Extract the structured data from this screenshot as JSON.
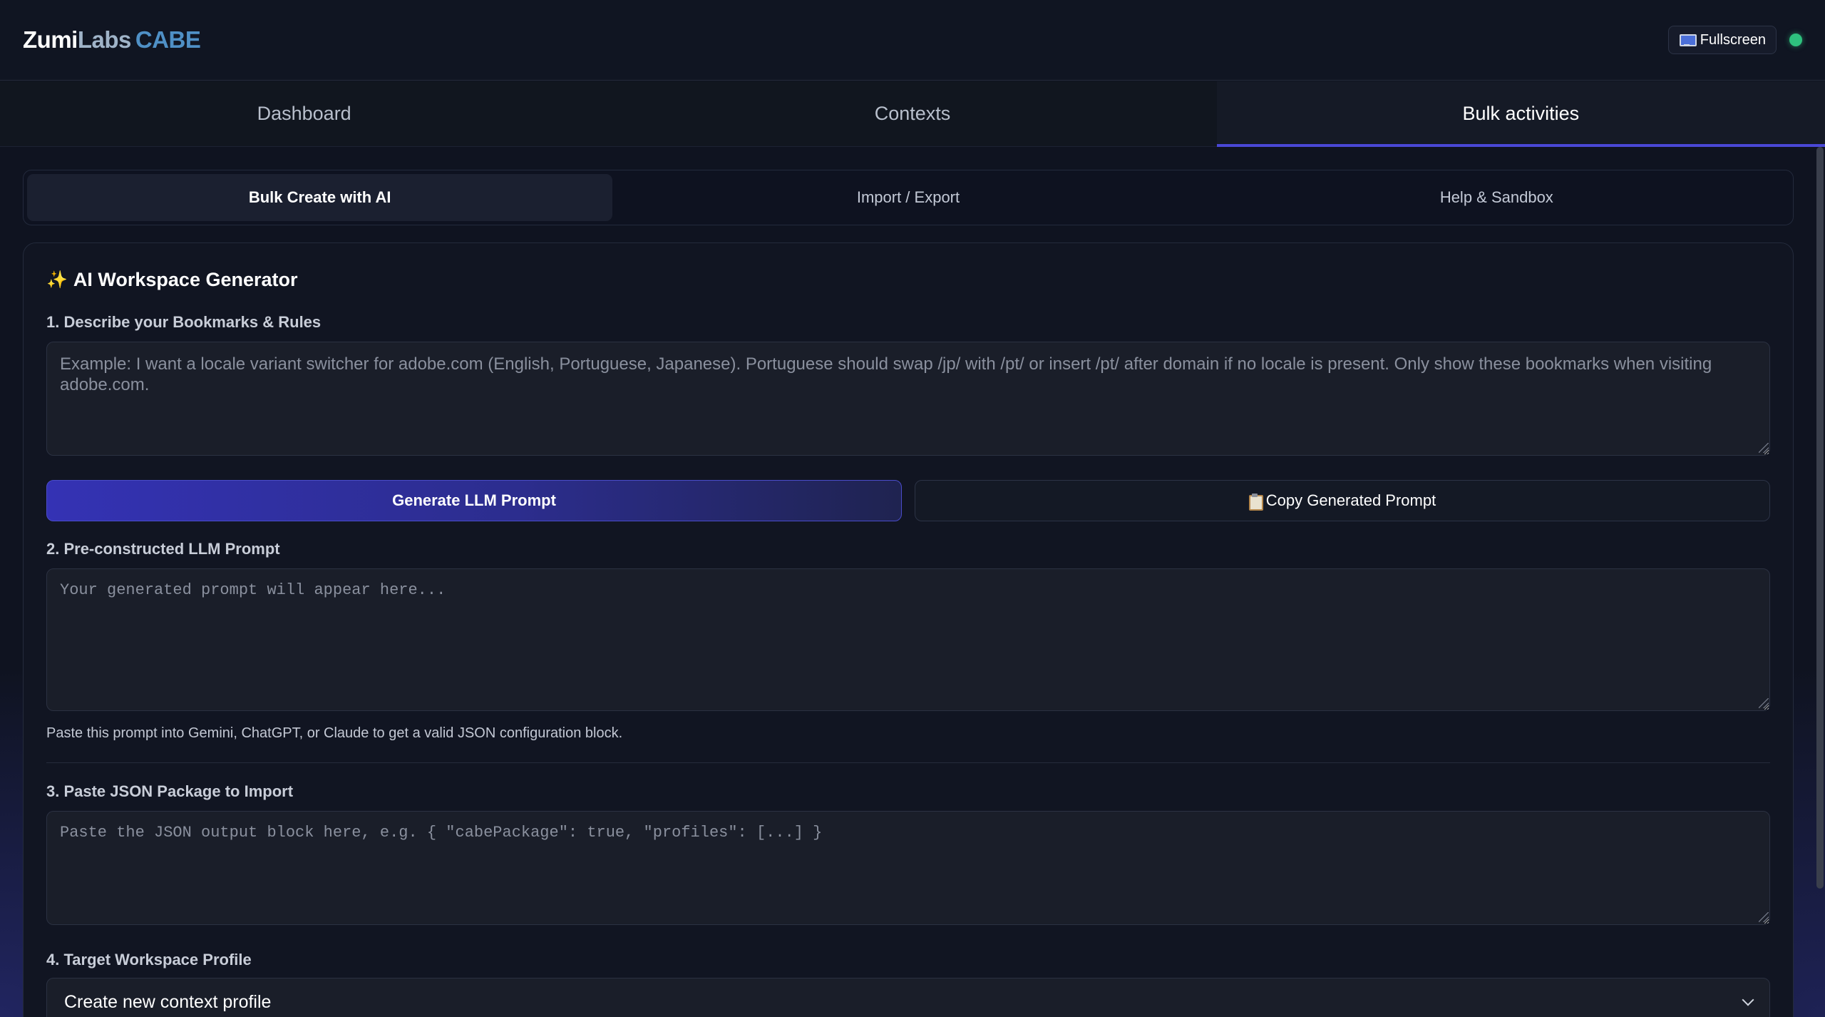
{
  "header": {
    "brand": {
      "part1": "Zumi",
      "part2": "Labs",
      "part3": "CABE"
    },
    "fullscreen_label": "Fullscreen",
    "status_color": "#2ec27e"
  },
  "main_tabs": [
    {
      "label": "Dashboard",
      "active": false
    },
    {
      "label": "Contexts",
      "active": false
    },
    {
      "label": "Bulk activities",
      "active": true
    }
  ],
  "sub_tabs": [
    {
      "label": "Bulk Create with AI",
      "active": true
    },
    {
      "label": "Import / Export",
      "active": false
    },
    {
      "label": "Help & Sandbox",
      "active": false
    }
  ],
  "generator": {
    "title": "AI Workspace Generator",
    "title_icon": "sparkle-icon",
    "step1": {
      "label": "1. Describe your Bookmarks & Rules",
      "placeholder": "Example: I want a locale variant switcher for adobe.com (English, Portuguese, Japanese). Portuguese should swap /jp/ with /pt/ or insert /pt/ after domain if no locale is present. Only show these bookmarks when visiting adobe.com.",
      "value": ""
    },
    "generate_button": "Generate LLM Prompt",
    "copy_button": "Copy Generated Prompt",
    "step2": {
      "label": "2. Pre-constructed LLM Prompt",
      "placeholder": "Your generated prompt will appear here...",
      "value": "",
      "helper": "Paste this prompt into Gemini, ChatGPT, or Claude to get a valid JSON configuration block."
    },
    "step3": {
      "label": "3. Paste JSON Package to Import",
      "placeholder": "Paste the JSON output block here, e.g. { \"cabePackage\": true, \"profiles\": [...] }",
      "value": ""
    },
    "step4": {
      "label": "4. Target Workspace Profile",
      "selected": "Create new context profile"
    }
  },
  "colors": {
    "accent": "#4a48d6",
    "brand_blue": "#4f90c6",
    "background": "#0f1320"
  }
}
